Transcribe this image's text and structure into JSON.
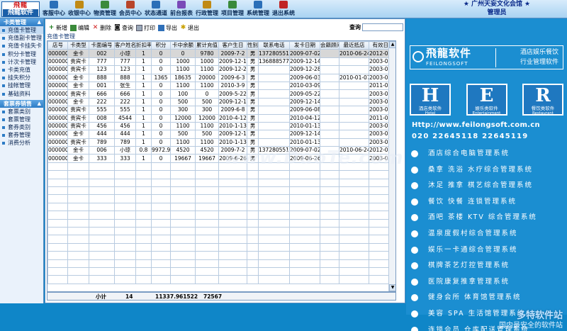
{
  "logo": {
    "top": "飛龍",
    "bottom": "飛龍软件"
  },
  "topmenu": [
    {
      "label": "客服中心",
      "icon": "headset-icon"
    },
    {
      "label": "收银中心",
      "icon": "cashier-icon"
    },
    {
      "label": "物资管理",
      "icon": "box-icon"
    },
    {
      "label": "会员中心",
      "icon": "member-icon"
    },
    {
      "label": "状态通道",
      "icon": "status-icon"
    },
    {
      "label": "前台报表",
      "icon": "report-icon"
    },
    {
      "label": "行政管理",
      "icon": "admin-icon"
    },
    {
      "label": "项目管理",
      "icon": "project-icon"
    },
    {
      "label": "系统管理",
      "icon": "system-icon"
    },
    {
      "label": "退出系统",
      "icon": "exit-icon"
    }
  ],
  "org": {
    "name": "广州天妄文化会馆",
    "user": "管理员",
    "star": "★"
  },
  "nav": {
    "section1": "卡类管理",
    "items1": [
      "充值卡管理",
      "充值副卡管理",
      "充值卡挂失卡",
      "积分卡管理",
      "计次卡管理",
      "卡类充值",
      "挂失积分",
      "挂帐管理",
      "基础资料"
    ],
    "section2": "套票券销售",
    "items2": [
      "套票类别",
      "套票管理",
      "套券类别",
      "套券管理",
      "消费分析"
    ]
  },
  "toolbar": {
    "add": "新增",
    "edit": "编辑",
    "delete": "删除",
    "query": "查询",
    "print": "打印",
    "export": "导出",
    "exit": "退出",
    "search_label": "查询",
    "search_value": ""
  },
  "panel_title": "充值卡管理",
  "grid": {
    "headers": [
      "店号",
      "卡类型",
      "卡面编号",
      "客户姓名",
      "折扣率",
      "积分",
      "卡中余额",
      "累计充值",
      "客户生日",
      "性别",
      "联系电话",
      "发卡日期",
      "会籍顾问",
      "最近抵店",
      "有效日期"
    ],
    "rows": [
      [
        "000000",
        "金卡",
        "002",
        "小琼",
        "1",
        "0",
        "0",
        "9780",
        "2009-7-2",
        "男",
        "13728055119",
        "2009-07-02",
        "",
        "2010-06-24",
        "2012-08-28"
      ],
      [
        "000000",
        "贵宾卡",
        "777",
        "777",
        "1",
        "0",
        "1000",
        "1000",
        "2009-12-14",
        "男",
        "13688857714",
        "2009-12-14",
        "",
        "",
        "2003-01-01"
      ],
      [
        "000000",
        "贵宾卡",
        "123",
        "123",
        "1",
        "0",
        "1100",
        "1100",
        "2009-12-28",
        "男",
        "",
        "2009-12-28",
        "",
        "",
        "2003-01-01"
      ],
      [
        "000000",
        "金卡",
        "888",
        "888",
        "1",
        "1365",
        "18635",
        "20000",
        "2009-6-3",
        "男",
        "",
        "2009-06-03",
        "",
        "2010-01-07",
        "2003-01-01"
      ],
      [
        "000000",
        "金卡",
        "001",
        "张生",
        "1",
        "0",
        "1100",
        "1100",
        "2010-3-9",
        "男",
        "",
        "2010-03-09",
        "",
        "",
        "2011-03-09"
      ],
      [
        "000000",
        "贵宾卡",
        "666",
        "666",
        "1",
        "0",
        "100",
        "0",
        "2009-5-22",
        "男",
        "",
        "2009-05-22",
        "",
        "",
        "2003-01-01"
      ],
      [
        "000000",
        "金卡",
        "222",
        "222",
        "1",
        "0",
        "500",
        "500",
        "2009-12-14",
        "男",
        "",
        "2009-12-14",
        "",
        "",
        "2003-01-01"
      ],
      [
        "000000",
        "贵宾卡",
        "555",
        "555",
        "1",
        "0",
        "300",
        "300",
        "2009-6-8",
        "男",
        "",
        "2009-06-08",
        "",
        "",
        "2003-01-01"
      ],
      [
        "000000",
        "贵宾卡",
        "008",
        "4544",
        "1",
        "0",
        "12000",
        "12000",
        "2010-4-12",
        "男",
        "",
        "2010-04-12",
        "",
        "",
        "2011-04-12"
      ],
      [
        "000000",
        "贵宾卡",
        "456",
        "456",
        "1",
        "0",
        "1100",
        "1100",
        "2010-1-13",
        "男",
        "",
        "2010-01-13",
        "",
        "",
        "2003-01-01"
      ],
      [
        "000000",
        "金卡",
        "444",
        "444",
        "1",
        "0",
        "500",
        "500",
        "2009-12-14",
        "男",
        "",
        "2009-12-14",
        "",
        "",
        "2003-01-01"
      ],
      [
        "000000",
        "贵宾卡",
        "789",
        "789",
        "1",
        "0",
        "1100",
        "1100",
        "2010-1-13",
        "男",
        "",
        "2010-01-13",
        "",
        "",
        "2003-01-01"
      ],
      [
        "000000",
        "金卡",
        "006",
        "小琼",
        "0.8",
        "9972.9",
        "4520",
        "4520",
        "2009-7-2",
        "男",
        "13728055119",
        "2009-07-02",
        "",
        "2010-06-24",
        "2012-08-28"
      ],
      [
        "000000",
        "金卡",
        "333",
        "333",
        "1",
        "0",
        "19667",
        "19667",
        "2009-6-26",
        "男",
        "",
        "2009-06-26",
        "",
        "",
        "2003-01-01"
      ]
    ],
    "selected_row": 0
  },
  "footer": {
    "label": "小计",
    "count": "14",
    "points": "11337.9",
    "balance": "61522",
    "total": "72567"
  },
  "ad": {
    "brand": "飛龍软件",
    "brand_en": "FEILONGSOFT",
    "tag1": "酒店娱乐餐饮",
    "tag2": "行业管理软件",
    "her": [
      {
        "letter": "H",
        "cap": "酒店类软件",
        "cap2": "Hotel"
      },
      {
        "letter": "E",
        "cap": "娱乐类软件",
        "cap2": "Entertainment"
      },
      {
        "letter": "R",
        "cap": "餐饮类软件",
        "cap2": "Restaurant"
      }
    ],
    "url": "Http://www.feilongsoft.com.cn",
    "phone": "020  22645118  22645119",
    "lines": [
      "酒店综合电脑管理系统",
      "桑拿 洗浴 水疗综合管理系统",
      "沐足 推拿 棋艺综合管理系统",
      "餐饮 快餐 连锁管理系统",
      "酒吧 茶楼 KTV 综合管理系统",
      "温泉度假村综合管理系统",
      "娱乐一卡通综合管理系统",
      "棋牌茶艺灯控管理系统",
      "医院康复推拿管理系统",
      "健身会所 体育馆管理系统",
      "美容 SPA 生活馆管理系统",
      "连锁会员 仓库配送管理系统"
    ]
  },
  "watermarks": {
    "mid": "www.DuoTe.com",
    "br": "多特软件站",
    "br2": "国内最安全的软件站"
  },
  "colors": {
    "accent": "#0f86c8",
    "nav_head": "#2d7cc6",
    "selected_row": "#d7d7d7"
  }
}
